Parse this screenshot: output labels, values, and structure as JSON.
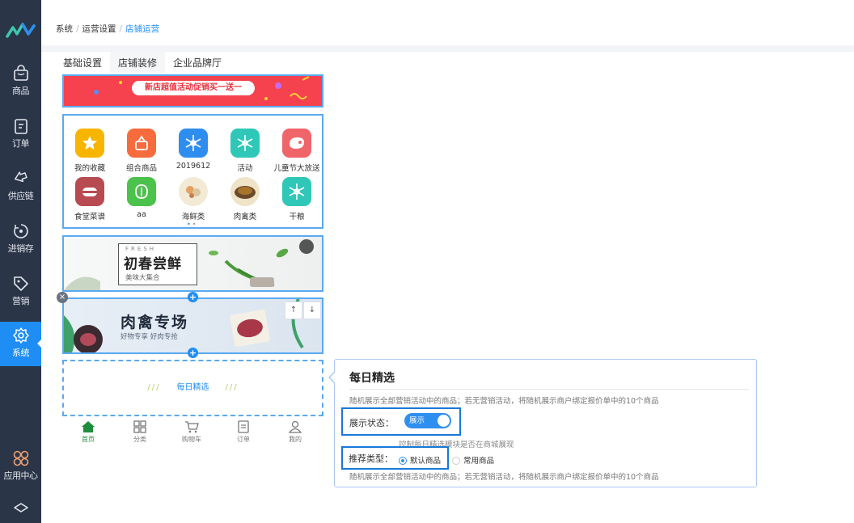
{
  "breadcrumb": {
    "items": [
      "系统",
      "运营设置"
    ],
    "current": "店铺运营"
  },
  "tabs": [
    "基础设置",
    "店铺装修",
    "企业品牌厅"
  ],
  "sidebar": {
    "items": [
      {
        "label": "商品",
        "icon": "bag-icon"
      },
      {
        "label": "订单",
        "icon": "order-icon"
      },
      {
        "label": "供应链",
        "icon": "exchange-icon"
      },
      {
        "label": "进销存",
        "icon": "inventory-icon"
      },
      {
        "label": "营销",
        "icon": "tag-icon"
      },
      {
        "label": "系统",
        "icon": "gear-icon"
      }
    ],
    "bottom_label": "应用中心"
  },
  "banner_top": {
    "text": "新店超值活动促销买一送一"
  },
  "category_grid": {
    "items": [
      {
        "label": "我的收藏",
        "color": "#f7b500"
      },
      {
        "label": "组合商品",
        "color": "#f76c3c"
      },
      {
        "label": "2019612",
        "color": "#2e8ef0"
      },
      {
        "label": "活动",
        "color": "#2fc7b8"
      },
      {
        "label": "儿童节大放送",
        "color": "#f0656a"
      },
      {
        "label": "食堂菜谱",
        "color": "#b84a52"
      },
      {
        "label": "aa",
        "color": "#4bc24b"
      },
      {
        "label": "海鲜类",
        "color": "#f2ead5"
      },
      {
        "label": "肉禽类",
        "color": "#efe3c8"
      },
      {
        "label": "干粮",
        "color": "#2fc7b8"
      }
    ]
  },
  "banner_fresh": {
    "en": "FRESH",
    "title": "初春尝鲜",
    "subtitle": "美味大集合"
  },
  "banner_meat": {
    "title": "肉禽专场",
    "subtitle": "好物专享 好肉专抢",
    "up": "↑",
    "down": "↓"
  },
  "daily_module": {
    "label": "每日精选",
    "slash": "///"
  },
  "tabbar": [
    "首页",
    "分类",
    "购物车",
    "订单",
    "我的"
  ],
  "panel": {
    "title": "每日精选",
    "description": "随机展示全部营销活动中的商品；若无营销活动，将随机展示商户绑定报价单中的10个商品",
    "display_label": "展示状态：",
    "toggle_text": "展示",
    "display_hint": "控制每日精选模块是否在商城展现",
    "type_label": "推荐类型：",
    "options": [
      "默认商品",
      "常用商品"
    ],
    "selected_option": "默认商品",
    "type_description": "随机展示全部营销活动中的商品；若无营销活动，将随机展示商户绑定报价单中的10个商品"
  },
  "colors": {
    "sidebar": "#2a3547",
    "accent": "#1e8ef5",
    "highlight": "#1878d8"
  }
}
